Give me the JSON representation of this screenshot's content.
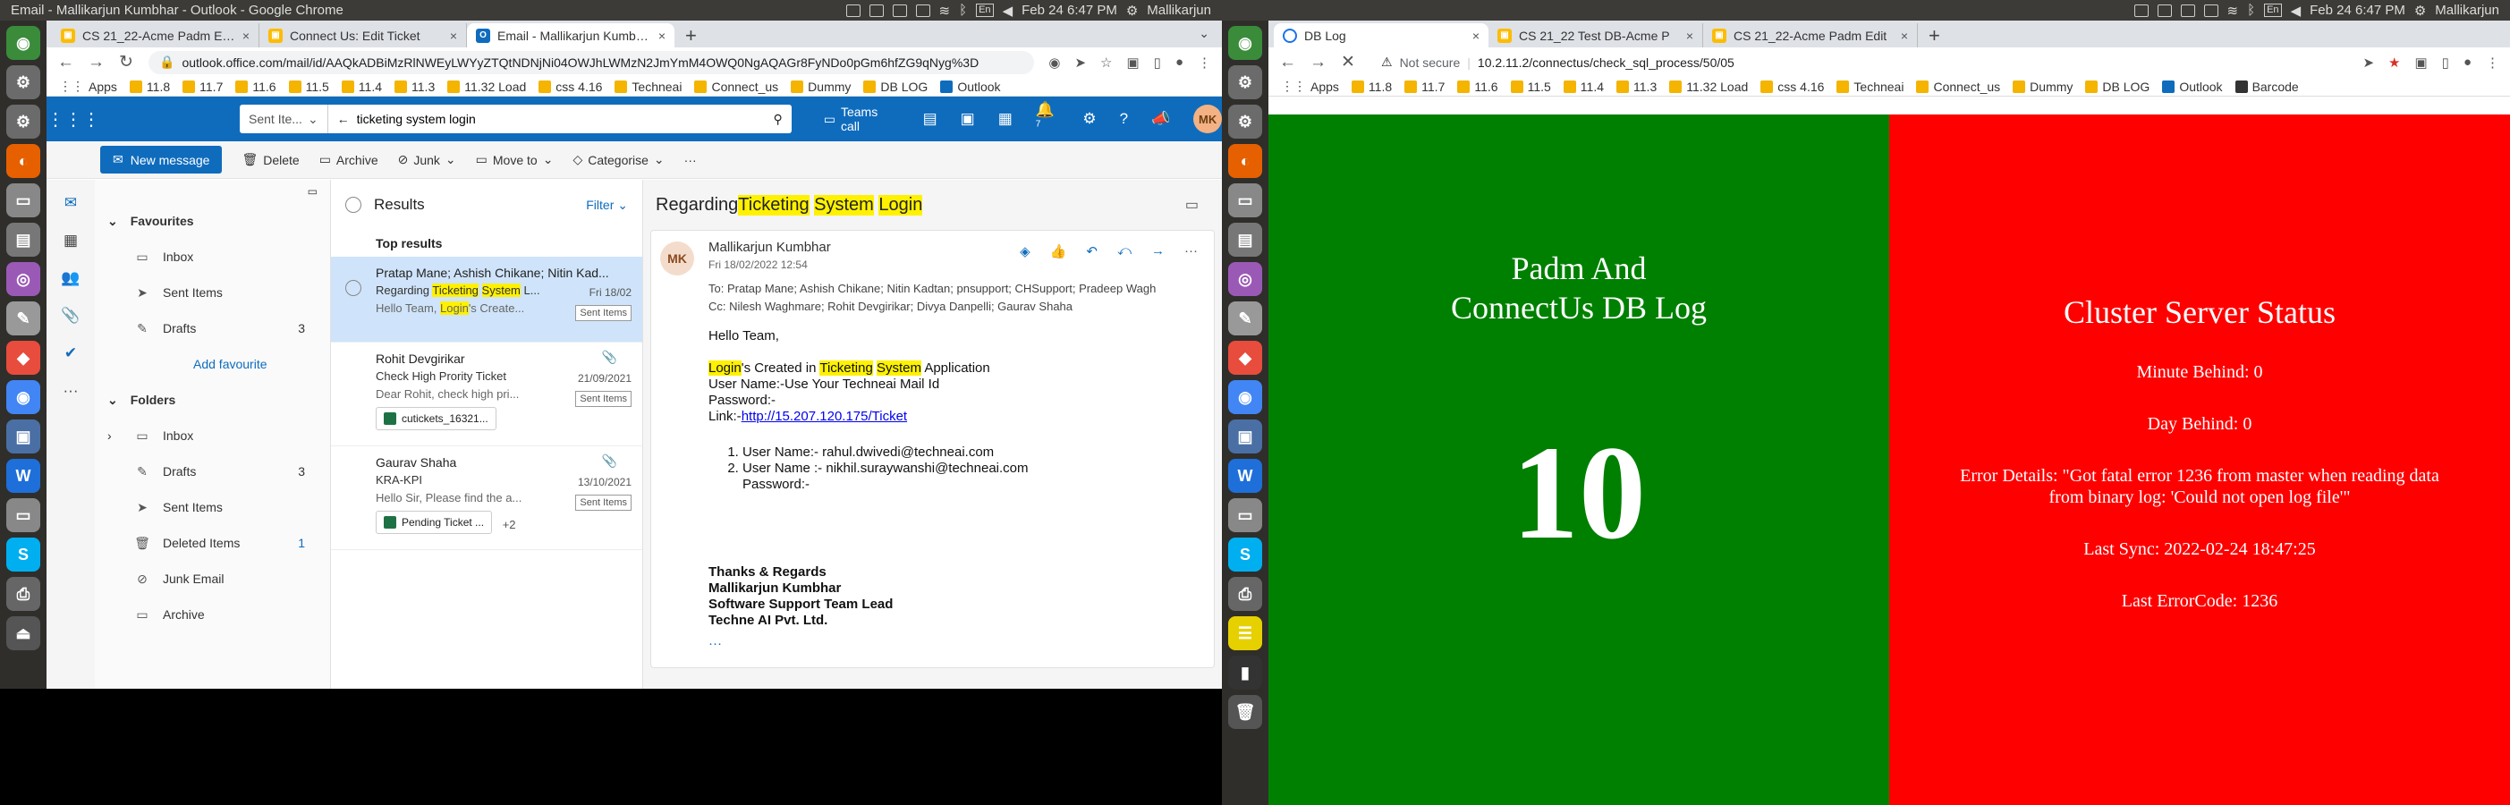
{
  "os": {
    "left_window_title": "Email - Mallikarjun Kumbhar - Outlook - Google Chrome",
    "clock": "Feb 24  6:47 PM",
    "user": "Mallikarjun",
    "lang": "En"
  },
  "left_chrome": {
    "tabs": [
      {
        "label": "CS 21_22-Acme Padm ERP",
        "close": "×"
      },
      {
        "label": "Connect Us: Edit Ticket",
        "close": "×"
      },
      {
        "label": "Email - Mallikarjun Kumbhar",
        "close": "×"
      }
    ],
    "newtab": "+",
    "url": "outlook.office.com/mail/id/AAQkADBiMzRlNWEyLWYyZTQtNDNjNi04OWJhLWMzN2JmYmM4OWQ0NgAQAGr8FyNDo0pGm6hfZG9qNyg%3D",
    "bookmarks": [
      "Apps",
      "11.8",
      "11.7",
      "11.6",
      "11.5",
      "11.4",
      "11.3",
      "11.32 Load",
      "css 4.16",
      "Techneai",
      "Connect_us",
      "Dummy",
      "DB LOG",
      "Outlook"
    ]
  },
  "outlook": {
    "search_scope": "Sent Ite...",
    "search_value": "ticketing system login",
    "teams_call": "Teams call",
    "avatar": "MK",
    "badge_count": "7",
    "ribbon": {
      "new_message": "New message",
      "delete": "Delete",
      "archive": "Archive",
      "junk": "Junk",
      "move_to": "Move to",
      "categorise": "Categorise",
      "more": "···"
    },
    "favourites_label": "Favourites",
    "favourites": [
      {
        "label": "Inbox",
        "count": ""
      },
      {
        "label": "Sent Items",
        "count": ""
      },
      {
        "label": "Drafts",
        "count": "3"
      }
    ],
    "add_favourite": "Add favourite",
    "folders_label": "Folders",
    "folders": [
      {
        "label": "Inbox",
        "count": ""
      },
      {
        "label": "Drafts",
        "count": "3"
      },
      {
        "label": "Sent Items",
        "count": ""
      },
      {
        "label": "Deleted Items",
        "count": "1"
      },
      {
        "label": "Junk Email",
        "count": ""
      },
      {
        "label": "Archive",
        "count": ""
      }
    ],
    "results_label": "Results",
    "filter_label": "Filter",
    "top_results": "Top results",
    "messages": [
      {
        "from": "Pratap Mane; Ashish Chikane; Nitin Kad...",
        "subject_pre": "Regarding ",
        "subject_hl1": "Ticketing",
        "subject_mid": " ",
        "subject_hl2": "System",
        "subject_post": " L...",
        "date": "Fri 18/02",
        "preview_pre": "Hello Team, ",
        "preview_hl": "Login",
        "preview_post": "'s Create...",
        "tag": "Sent Items"
      },
      {
        "from": "Rohit Devgirikar",
        "subject": "Check High Prority Ticket",
        "date": "21/09/2021",
        "preview": "Dear Rohit, check high pri...",
        "tag": "Sent Items",
        "attachment": "cutickets_16321..."
      },
      {
        "from": "Gaurav Shaha",
        "subject": "KRA-KPI",
        "date": "13/10/2021",
        "preview": "Hello Sir, Please find the a...",
        "tag": "Sent Items",
        "attachment": "Pending Ticket ...",
        "more": "+2"
      }
    ],
    "reading": {
      "subject_pre": "Regarding ",
      "subject_hl1": "Ticketing",
      "subject_hl2": "System",
      "subject_hl3": "Login",
      "avatar": "MK",
      "sender": "Mallikarjun Kumbhar",
      "date": "Fri 18/02/2022 12:54",
      "to": "To:  Pratap Mane; Ashish Chikane; Nitin Kadtan; pnsupport; CHSupport; Pradeep Wagh",
      "cc": "Cc:  Nilesh Waghmare; Rohit Devgirikar; Divya Danpelli; Gaurav Shaha",
      "greeting": "Hello Team,",
      "line1_hl1": "Login",
      "line1_a": "'s Created in ",
      "line1_hl2": "Ticketing",
      "line1_hl3": "System",
      "line1_b": " Application",
      "line2": "User Name:-Use Your Techneai Mail Id",
      "line3": "Password:-",
      "link_prefix": "Link:-",
      "link": "http://15.207.120.175/Ticket",
      "users": [
        "User Name:- rahul.dwivedi@techneai.com",
        "User Name :- nikhil.suraywanshi@techneai.com"
      ],
      "pw": "Password:-",
      "sig": [
        "Thanks & Regards",
        "Mallikarjun Kumbhar",
        "Software Support Team Lead",
        "Techne AI Pvt. Ltd."
      ],
      "ellipsis": "···"
    }
  },
  "right_chrome": {
    "tabs": [
      {
        "label": "DB Log",
        "close": "×"
      },
      {
        "label": "CS 21_22 Test DB-Acme P",
        "close": "×"
      },
      {
        "label": "CS 21_22-Acme Padm Edit",
        "close": "×"
      }
    ],
    "newtab": "+",
    "not_secure": "Not secure",
    "url": "10.2.11.2/connectus/check_sql_process/50/05",
    "bookmarks": [
      "Apps",
      "11.8",
      "11.7",
      "11.6",
      "11.5",
      "11.4",
      "11.3",
      "11.32 Load",
      "css 4.16",
      "Techneai",
      "Connect_us",
      "Dummy",
      "DB LOG",
      "Outlook",
      "Barcode"
    ]
  },
  "dblog": {
    "left_title_1": "Padm And",
    "left_title_2": "ConnectUs DB Log",
    "left_number": "10",
    "right_title": "Cluster Server Status",
    "minute_behind": "Minute Behind: 0",
    "day_behind": "Day Behind: 0",
    "error_details": "Error Details: \"Got fatal error 1236 from master when reading data from binary log: 'Could not open log file'\"",
    "last_sync": "Last Sync: 2022-02-24 18:47:25",
    "last_error": "Last ErrorCode: 1236"
  },
  "colors": {
    "outlook_blue": "#0f6cbd",
    "green_panel": "#008000",
    "red_panel": "#ff0000",
    "highlight": "#fff100"
  }
}
